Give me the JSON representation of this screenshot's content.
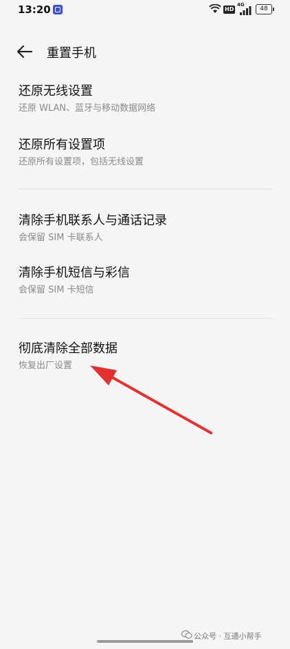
{
  "status_bar": {
    "time": "13:20",
    "network": "HD",
    "signal_type": "4G",
    "battery": "48"
  },
  "header": {
    "title": "重置手机",
    "back_icon": "arrow-left-icon"
  },
  "items": [
    {
      "title": "还原无线设置",
      "subtitle": "还原 WLAN、蓝牙与移动数据网络"
    },
    {
      "title": "还原所有设置项",
      "subtitle": "还原所有设置项，包括无线设置"
    },
    {
      "title": "清除手机联系人与通话记录",
      "subtitle": "会保留 SIM 卡联系人"
    },
    {
      "title": "清除手机短信与彩信",
      "subtitle": "会保留 SIM 卡短信"
    },
    {
      "title": "彻底清除全部数据",
      "subtitle": "恢复出厂设置"
    }
  ],
  "watermark": "公众号 · 互通小帮手",
  "colors": {
    "background": "#f5f5f5",
    "annotation_arrow": "#e53030",
    "subtitle": "#8a8a8a"
  }
}
